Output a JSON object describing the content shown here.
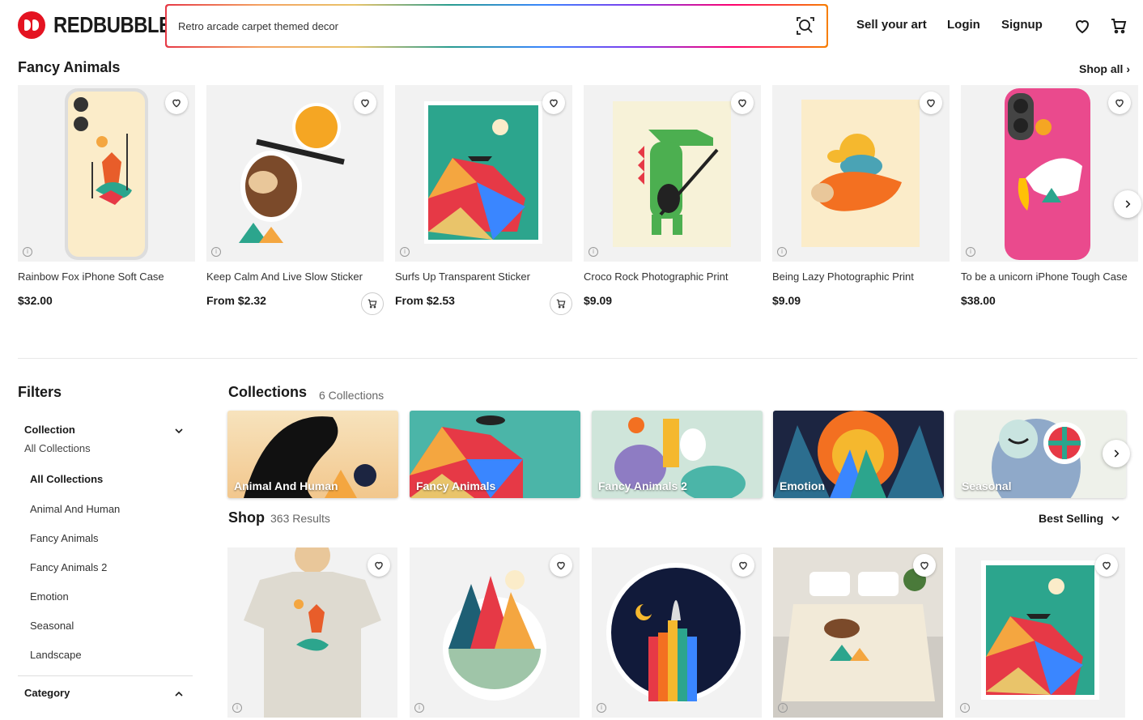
{
  "header": {
    "logo_text": "REDBUBBLE",
    "search_value": "Retro arcade carpet themed decor",
    "sell_label": "Sell your art",
    "login_label": "Login",
    "signup_label": "Signup"
  },
  "featured": {
    "title": "Fancy Animals",
    "shop_all": "Shop all",
    "products": [
      {
        "name": "Rainbow Fox iPhone Soft Case",
        "price": "$32.00"
      },
      {
        "name": "Keep Calm And Live Slow Sticker",
        "price": "From $2.32"
      },
      {
        "name": "Surfs Up Transparent Sticker",
        "price": "From $2.53"
      },
      {
        "name": "Croco Rock Photographic Print",
        "price": "$9.09"
      },
      {
        "name": "Being Lazy Photographic Print",
        "price": "$9.09"
      },
      {
        "name": "To be a unicorn iPhone Tough Case",
        "price": "$38.00"
      }
    ]
  },
  "filters": {
    "title": "Filters",
    "collection_label": "Collection",
    "collection_selected": "All Collections",
    "items": [
      "All Collections",
      "Animal And Human",
      "Fancy Animals",
      "Fancy Animals 2",
      "Emotion",
      "Seasonal",
      "Landscape"
    ],
    "category_label": "Category"
  },
  "collections": {
    "title": "Collections",
    "count": "6 Collections",
    "cards": [
      "Animal And Human",
      "Fancy Animals",
      "Fancy Animals 2",
      "Emotion",
      "Seasonal"
    ]
  },
  "shop": {
    "title": "Shop",
    "count": "363 Results",
    "sort_label": "Best Selling"
  }
}
